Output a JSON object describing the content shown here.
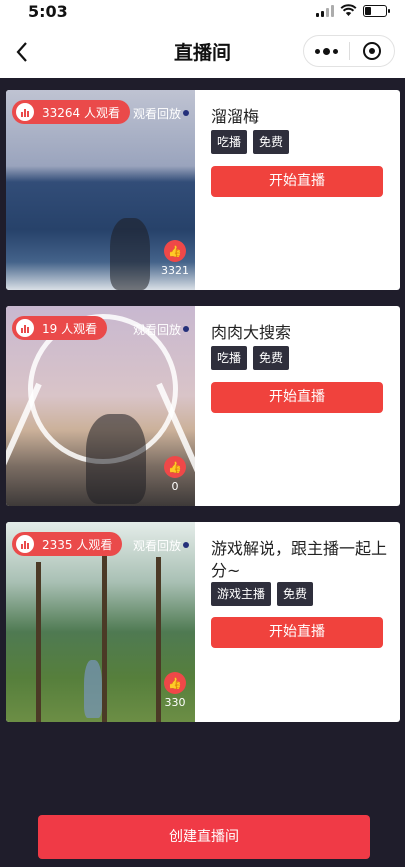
{
  "status_bar": {
    "time": "5:03"
  },
  "nav": {
    "title": "直播间"
  },
  "rooms": [
    {
      "viewers": "33264 人观看",
      "replay_label": "观看回放",
      "likes": "3321",
      "title": "溜溜梅",
      "tags": [
        "吃播",
        "免费"
      ],
      "start_label": "开始直播"
    },
    {
      "viewers": "19 人观看",
      "replay_label": "观看回放",
      "likes": "0",
      "title": "肉肉大搜索",
      "tags": [
        "吃播",
        "免费"
      ],
      "start_label": "开始直播"
    },
    {
      "viewers": "2335 人观看",
      "replay_label": "观看回放",
      "likes": "330",
      "title": "游戏解说，跟主播一起上分~",
      "tags": [
        "游戏主播",
        "免费"
      ],
      "start_label": "开始直播"
    }
  ],
  "create_button": "创建直播间",
  "colors": {
    "accent": "#f0423d",
    "background": "#1f1d2b",
    "tag": "#2f2f3c"
  }
}
